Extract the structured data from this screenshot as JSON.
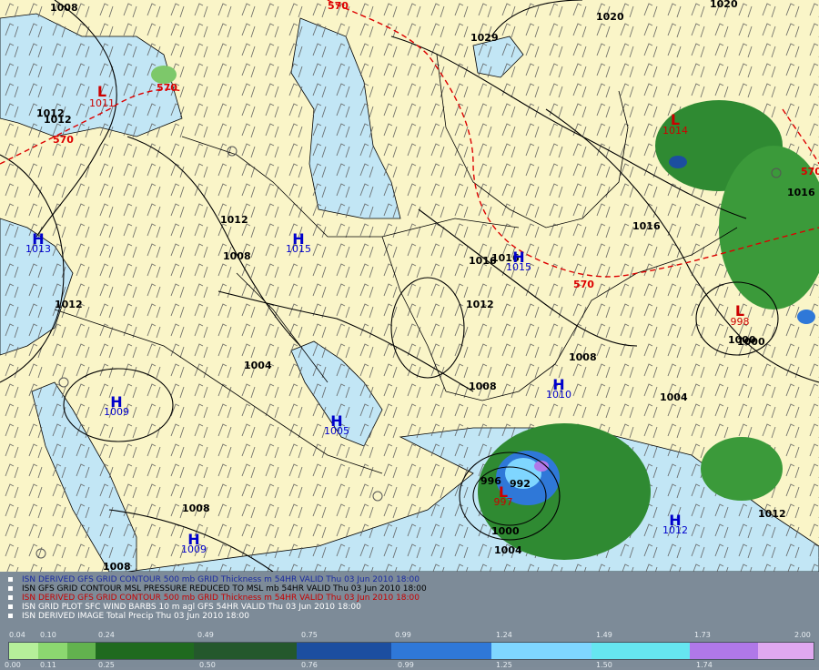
{
  "map": {
    "pressure_highs": [
      {
        "marker": "H",
        "value": "1015"
      },
      {
        "marker": "H",
        "value": "1013"
      },
      {
        "marker": "H",
        "value": "1015"
      },
      {
        "marker": "H",
        "value": "1009"
      },
      {
        "marker": "H",
        "value": "1005"
      },
      {
        "marker": "H",
        "value": "1010"
      },
      {
        "marker": "H",
        "value": "1009"
      },
      {
        "marker": "H",
        "value": "1012"
      }
    ],
    "pressure_lows": [
      {
        "marker": "L",
        "value": "1011"
      },
      {
        "marker": "L",
        "value": "1014"
      },
      {
        "marker": "L",
        "value": "998"
      },
      {
        "marker": "L",
        "value": "997"
      }
    ],
    "isobar_labels": [
      "1008",
      "1012",
      "1020",
      "1012",
      "1029",
      "1020",
      "1012",
      "1008",
      "1016",
      "1016",
      "1012",
      "1008",
      "1004",
      "1008",
      "1004",
      "1008",
      "1000",
      "1000",
      "1004",
      "1000",
      "1012",
      "1008",
      "1012",
      "1016",
      "1016",
      "996",
      "992"
    ],
    "thickness_labels": [
      "570",
      "570",
      "570",
      "570",
      "570"
    ],
    "colors": {
      "land": "#faf5c8",
      "water": "#c2e6f5",
      "isobar": "#000000",
      "thickness": "#dd0000",
      "high": "#0000cc",
      "low": "#cc0000",
      "wind_barb": "#555555"
    }
  },
  "legend": {
    "lines": [
      {
        "text": "ISN DERIVED GFS GRID CONTOUR 500 mb GRID Thickness m 54HR VALID Thu 03 Jun 2010 18:00",
        "color": "#1a2aa0"
      },
      {
        "text": "ISN GFS GRID CONTOUR MSL PRESSURE REDUCED TO MSL mb 54HR VALID Thu 03 Jun 2010 18:00",
        "color": "#000000"
      },
      {
        "text": "ISN DERIVED GFS GRID CONTOUR 500 mb GRID Thickness m 54HR VALID Thu 03 Jun 2010 18:00",
        "color": "#c80000"
      },
      {
        "text": "ISN GRID PLOT SFC WIND BARBS 10 m agl GFS 54HR VALID Thu 03 Jun 2010 18:00",
        "color": "#ffffff"
      },
      {
        "text": "ISN DERIVED IMAGE Total Precip Thu 03 Jun 2010 18:00",
        "color": "#ffffff"
      }
    ],
    "colorbar": {
      "top_labels": [
        "0.04",
        "0.10",
        "0.24",
        "0.49",
        "0.75",
        "0.99",
        "1.24",
        "1.49",
        "1.73",
        "2.00"
      ],
      "bottom_labels": [
        "0.00",
        "0.11",
        "0.25",
        "0.50",
        "0.76",
        "0.99",
        "1.25",
        "1.50",
        "1.74"
      ],
      "segments": [
        "#b6f09a",
        "#8cd870",
        "#62b24e",
        "#1f6a1f",
        "#24582c",
        "#1c4ea0",
        "#2f78d8",
        "#7fd6ff",
        "#66e6f0",
        "#b078e8",
        "#e0a8f0"
      ]
    }
  }
}
